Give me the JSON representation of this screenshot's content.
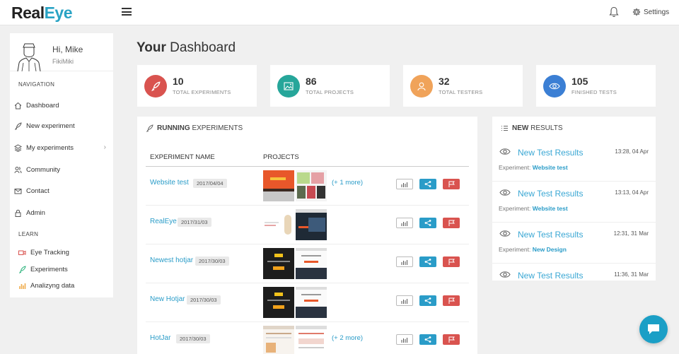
{
  "app": {
    "logo_part1": "Real",
    "logo_part2": "Eye",
    "settings_label": "Settings"
  },
  "profile": {
    "greeting": "Hi, Mike",
    "username": "FikiMiki"
  },
  "sidebar": {
    "navigation_heading": "NAVIGATION",
    "nav_items": [
      {
        "label": "Dashboard",
        "icon": "home-icon"
      },
      {
        "label": "New experiment",
        "icon": "rocket-icon"
      },
      {
        "label": "My experiments",
        "icon": "layers-icon"
      },
      {
        "label": "Community",
        "icon": "users-icon"
      },
      {
        "label": "Contact",
        "icon": "envelope-icon"
      },
      {
        "label": "Admin",
        "icon": "lock-icon"
      }
    ],
    "learn_heading": "LEARN",
    "learn_items": [
      {
        "label": "Eye Tracking",
        "icon": "video-icon",
        "color": "#d9534f"
      },
      {
        "label": "Experiments",
        "icon": "rocket-icon",
        "color": "#2ab27b"
      },
      {
        "label": "Analizyng data",
        "icon": "bar-chart-icon",
        "color": "#f0ad4e"
      }
    ]
  },
  "dashboard": {
    "title_bold": "Your",
    "title_rest": " Dashboard"
  },
  "stats": [
    {
      "value": "10",
      "label": "TOTAL EXPERIMENTS",
      "icon": "rocket-icon",
      "color": "#d9534f"
    },
    {
      "value": "86",
      "label": "TOTAL PROJECTS",
      "icon": "image-icon",
      "color": "#26a69a"
    },
    {
      "value": "32",
      "label": "TOTAL TESTERS",
      "icon": "user-icon",
      "color": "#f0a35a"
    },
    {
      "value": "105",
      "label": "FINISHED TESTS",
      "icon": "eye-icon",
      "color": "#3b7fd4"
    }
  ],
  "running": {
    "heading_bold": "RUNNING",
    "heading_rest": "EXPERIMENTS",
    "col_name": "EXPERIMENT NAME",
    "col_projects": "PROJECTS",
    "rows": [
      {
        "name": "Website test",
        "date": "2017/04/04",
        "more": "(+ 1 more)"
      },
      {
        "name": "RealEye",
        "date": "2017/31/03",
        "more": ""
      },
      {
        "name": "Newest hotjar",
        "date": "2017/30/03",
        "more": ""
      },
      {
        "name": "New Hotjar",
        "date": "2017/30/03",
        "more": ""
      },
      {
        "name": "HotJar",
        "date": "2017/30/03",
        "more": "(+ 2 more)"
      }
    ]
  },
  "results": {
    "heading_bold": "NEW",
    "heading_rest": "RESULTS",
    "experiment_label": "Experiment:",
    "items": [
      {
        "title": "New Test Results",
        "time": "13:28, 04 Apr",
        "experiment": "Website test"
      },
      {
        "title": "New Test Results",
        "time": "13:13, 04 Apr",
        "experiment": "Website test"
      },
      {
        "title": "New Test Results",
        "time": "12:31, 31 Mar",
        "experiment": "New Design"
      },
      {
        "title": "New Test Results",
        "time": "11:36, 31 Mar",
        "experiment": ""
      }
    ]
  },
  "colors": {
    "accent": "#2a9cc8",
    "danger": "#d9534f",
    "background": "#f0f0f0"
  }
}
